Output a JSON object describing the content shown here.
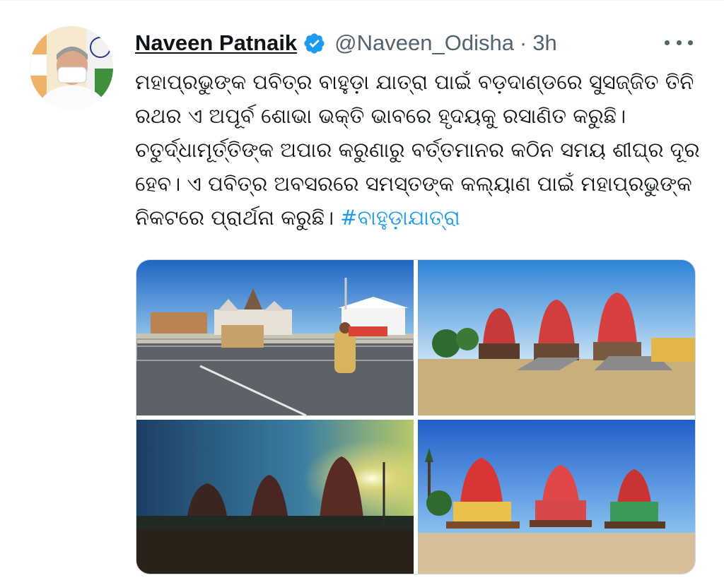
{
  "tweet": {
    "author_name": "Naveen Patnaik",
    "handle": "@Naveen_Odisha",
    "separator": "·",
    "time": "3h",
    "text_lines": [
      "ମହାପ୍ରଭୁଙ୍କ ପବିତ୍ର ବାହୁଡ଼ା ଯାତ୍ରା ପାଇଁ ବଡ଼ଦାଣ୍ଡରେ ସୁସଜ୍ଜିତ ତିନି",
      "ରଥର ଏ ଅପୂର୍ବ ଶୋଭା ଭକ୍ତି ଭାବରେ ହୃଦୟକୁ ରସାଣିତ କରୁଛି।",
      "ଚତୁର୍ଦ୍ଧାମୂର୍ତ୍ତିଙ୍କ ଅପାର କରୁଣାରୁ ବର୍ତ୍ତମାନର କଠିନ ସମୟ ଶୀଘ୍ର ଦୂର",
      "ହେବ। ଏ ପବିତ୍ର ଅବସରରେ ସମସ୍ତଙ୍କ କଲ୍ୟାଣ ପାଇଁ ମହାପ୍ରଭୁଙ୍କ"
    ],
    "last_line_text": "ନିକଟରେ ପ୍ରାର୍ଥନା କରୁଛି। ",
    "hashtag": "#ବାହୁଡ଼ାଯାତ୍ରା",
    "photos_count": 4
  },
  "icons": {
    "verified": "verified-badge-icon",
    "more": "more-options-icon"
  },
  "colors": {
    "link": "#1d9bf0",
    "secondary_text": "#536471",
    "primary_text": "#0f1419",
    "border": "#cfd9de"
  }
}
